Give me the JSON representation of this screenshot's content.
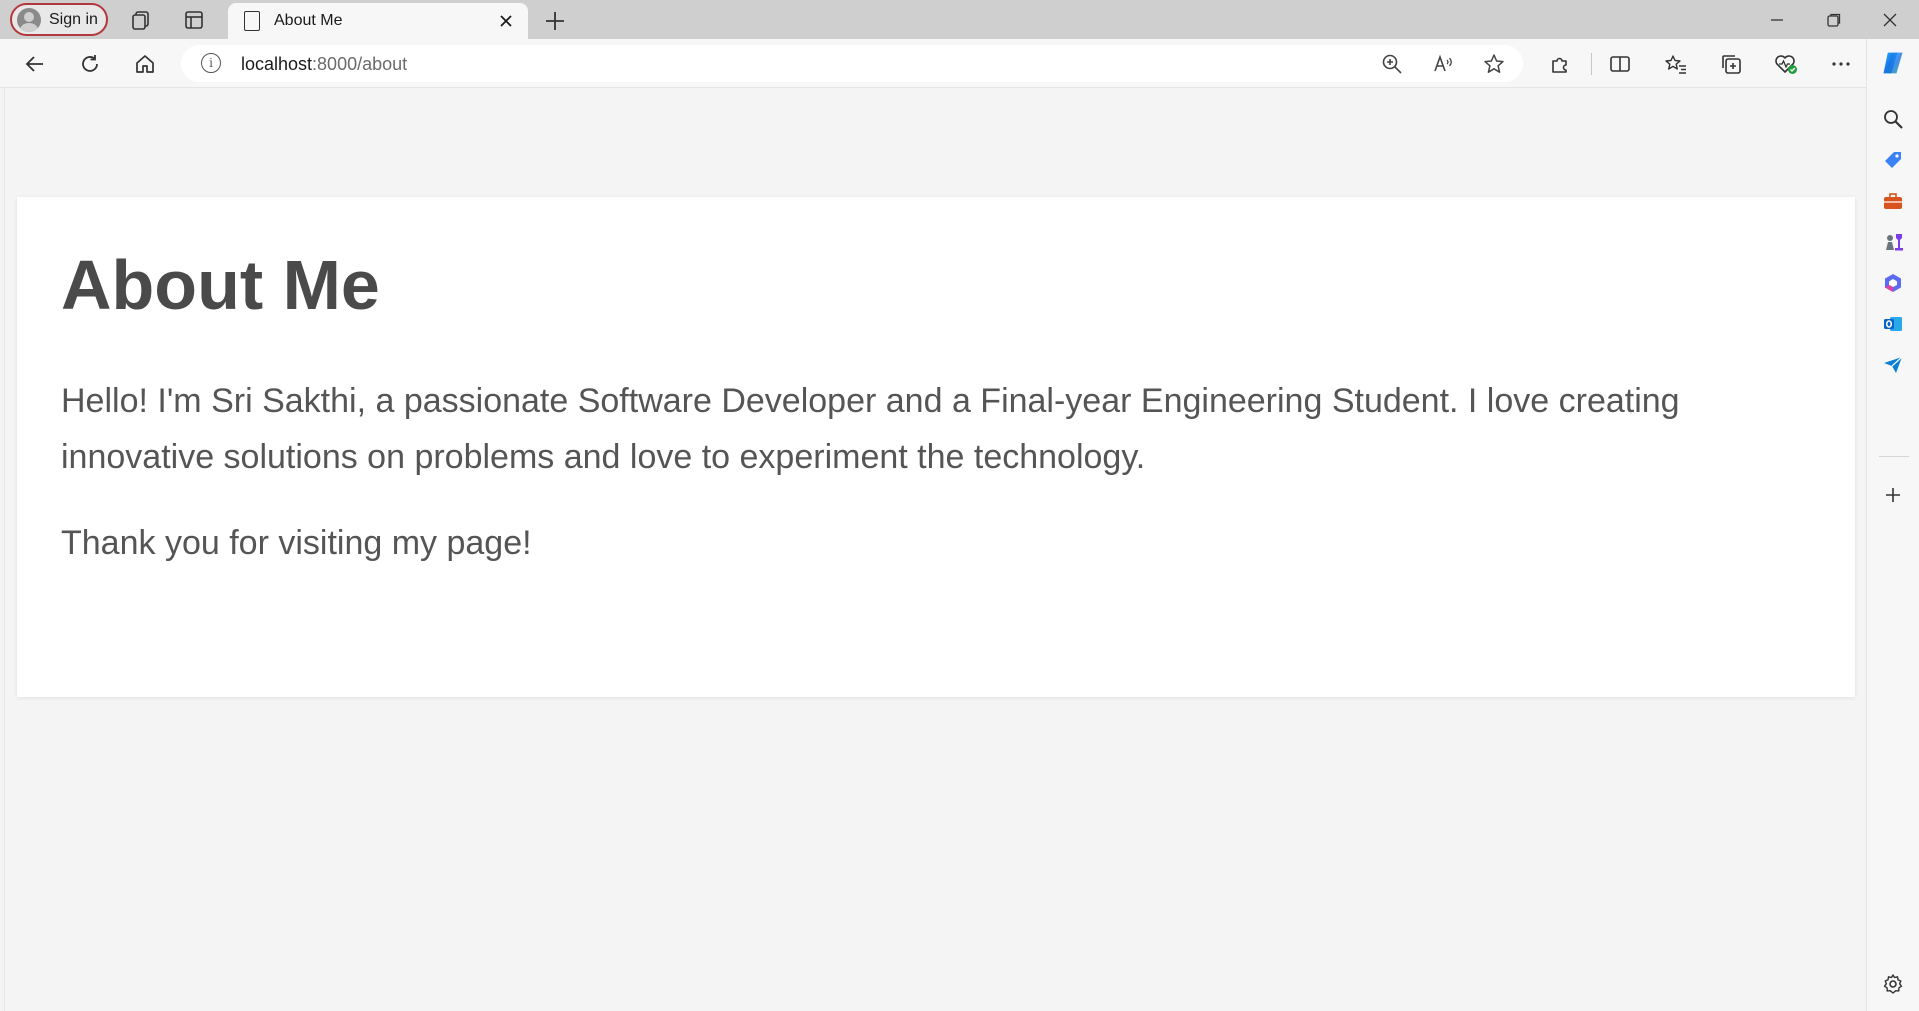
{
  "browser": {
    "signin_label": "Sign in",
    "tab": {
      "title": "About Me"
    },
    "address": {
      "host": "localhost",
      "path": ":8000/about"
    },
    "accent_color": "#1a73e8"
  },
  "page": {
    "heading": "About Me",
    "paragraphs": [
      "Hello! I'm Sri Sakthi, a passionate Software Developer and a Final-year Engineering Student. I love creating innovative solutions on problems and love to experiment the technology.",
      "Thank you for visiting my page!"
    ]
  },
  "icons": {
    "sidebar": [
      "search-icon",
      "tag-icon",
      "briefcase-icon",
      "chess-icon",
      "office-icon",
      "outlook-icon",
      "send-icon",
      "plus-icon",
      "gear-icon"
    ]
  }
}
